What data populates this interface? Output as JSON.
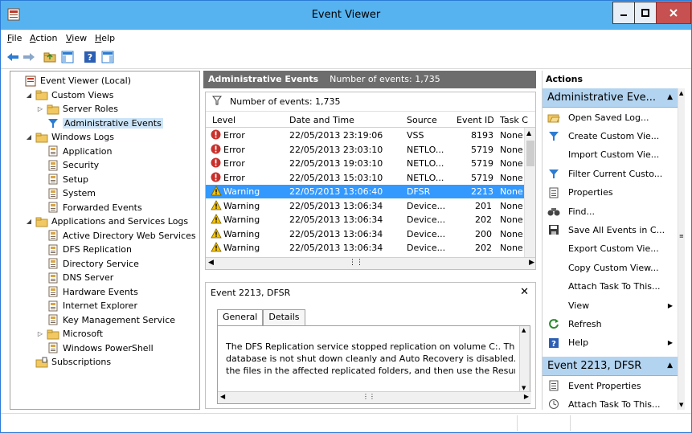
{
  "window": {
    "title": "Event Viewer"
  },
  "menu": [
    {
      "label": "File"
    },
    {
      "label": "Action"
    },
    {
      "label": "View"
    },
    {
      "label": "Help"
    }
  ],
  "tree": {
    "items": [
      {
        "label": "Event Viewer (Local)",
        "icon": "event-viewer-icon",
        "expander": ""
      },
      {
        "label": "Custom Views",
        "icon": "folder-icon",
        "expander": "◢"
      },
      {
        "label": "Server Roles",
        "icon": "folder-icon",
        "expander": "▷"
      },
      {
        "label": "Administrative Events",
        "icon": "filter-icon",
        "expander": ""
      },
      {
        "label": "Windows Logs",
        "icon": "folder-icon",
        "expander": "◢"
      },
      {
        "label": "Application",
        "icon": "log-icon",
        "expander": ""
      },
      {
        "label": "Security",
        "icon": "log-icon",
        "expander": ""
      },
      {
        "label": "Setup",
        "icon": "log-icon",
        "expander": ""
      },
      {
        "label": "System",
        "icon": "log-icon",
        "expander": ""
      },
      {
        "label": "Forwarded Events",
        "icon": "log-icon",
        "expander": ""
      },
      {
        "label": "Applications and Services Logs",
        "icon": "folder-icon",
        "expander": "◢"
      },
      {
        "label": "Active Directory Web Services",
        "icon": "log-icon",
        "expander": ""
      },
      {
        "label": "DFS Replication",
        "icon": "log-icon",
        "expander": ""
      },
      {
        "label": "Directory Service",
        "icon": "log-icon",
        "expander": ""
      },
      {
        "label": "DNS Server",
        "icon": "log-icon",
        "expander": ""
      },
      {
        "label": "Hardware Events",
        "icon": "log-icon",
        "expander": ""
      },
      {
        "label": "Internet Explorer",
        "icon": "log-icon",
        "expander": ""
      },
      {
        "label": "Key Management Service",
        "icon": "log-icon",
        "expander": ""
      },
      {
        "label": "Microsoft",
        "icon": "folder-icon",
        "expander": "▷"
      },
      {
        "label": "Windows PowerShell",
        "icon": "log-icon",
        "expander": ""
      },
      {
        "label": "Subscriptions",
        "icon": "subscriptions-icon",
        "expander": ""
      }
    ]
  },
  "middle": {
    "header_title": "Administrative Events",
    "header_count": "Number of events: 1,735",
    "filter_text": "Number of events: 1,735",
    "columns": [
      "Level",
      "Date and Time",
      "Source",
      "Event ID",
      "Task C"
    ],
    "rows": [
      {
        "level": "Error",
        "date": "22/05/2013 23:19:06",
        "source": "VSS",
        "id": "8193",
        "task": "None"
      },
      {
        "level": "Error",
        "date": "22/05/2013 23:03:10",
        "source": "NETLO...",
        "id": "5719",
        "task": "None"
      },
      {
        "level": "Error",
        "date": "22/05/2013 19:03:10",
        "source": "NETLO...",
        "id": "5719",
        "task": "None"
      },
      {
        "level": "Error",
        "date": "22/05/2013 15:03:10",
        "source": "NETLO...",
        "id": "5719",
        "task": "None"
      },
      {
        "level": "Warning",
        "date": "22/05/2013 13:06:40",
        "source": "DFSR",
        "id": "2213",
        "task": "None"
      },
      {
        "level": "Warning",
        "date": "22/05/2013 13:06:34",
        "source": "Device...",
        "id": "201",
        "task": "None"
      },
      {
        "level": "Warning",
        "date": "22/05/2013 13:06:34",
        "source": "Device...",
        "id": "202",
        "task": "None"
      },
      {
        "level": "Warning",
        "date": "22/05/2013 13:06:34",
        "source": "Device...",
        "id": "200",
        "task": "None"
      },
      {
        "level": "Warning",
        "date": "22/05/2013 13:06:34",
        "source": "Device...",
        "id": "202",
        "task": "None"
      }
    ],
    "detail": {
      "title": "Event 2213, DFSR",
      "tabs": [
        "General",
        "Details"
      ],
      "lines": [
        "The DFS Replication service stopped replication on volume C:. This occ",
        "database is not shut down cleanly and Auto Recovery is disabled. To re",
        "the files in the affected replicated folders, and then use the ResumeRep"
      ]
    }
  },
  "actions": {
    "title": "Actions",
    "group1": "Administrative Eve...",
    "items1": [
      {
        "label": "Open Saved Log...",
        "icon": "open-folder-icon",
        "sub": ""
      },
      {
        "label": "Create Custom Vie...",
        "icon": "filter-icon",
        "sub": ""
      },
      {
        "label": "Import Custom Vie...",
        "icon": "",
        "sub": ""
      },
      {
        "label": "Filter Current Custo...",
        "icon": "filter-icon",
        "sub": ""
      },
      {
        "label": "Properties",
        "icon": "properties-icon",
        "sub": ""
      },
      {
        "label": "Find...",
        "icon": "binoculars-icon",
        "sub": ""
      },
      {
        "label": "Save All Events in C...",
        "icon": "save-icon",
        "sub": ""
      },
      {
        "label": "Export Custom Vie...",
        "icon": "",
        "sub": ""
      },
      {
        "label": "Copy Custom View...",
        "icon": "",
        "sub": ""
      },
      {
        "label": "Attach Task To This...",
        "icon": "",
        "sub": ""
      },
      {
        "label": "View",
        "icon": "",
        "sub": "▶"
      },
      {
        "label": "Refresh",
        "icon": "refresh-icon",
        "sub": ""
      },
      {
        "label": "Help",
        "icon": "help-icon",
        "sub": "▶"
      }
    ],
    "group2": "Event 2213, DFSR",
    "items2": [
      {
        "label": "Event Properties",
        "icon": "properties-icon",
        "sub": ""
      },
      {
        "label": "Attach Task To This...",
        "icon": "task-icon",
        "sub": ""
      }
    ]
  }
}
